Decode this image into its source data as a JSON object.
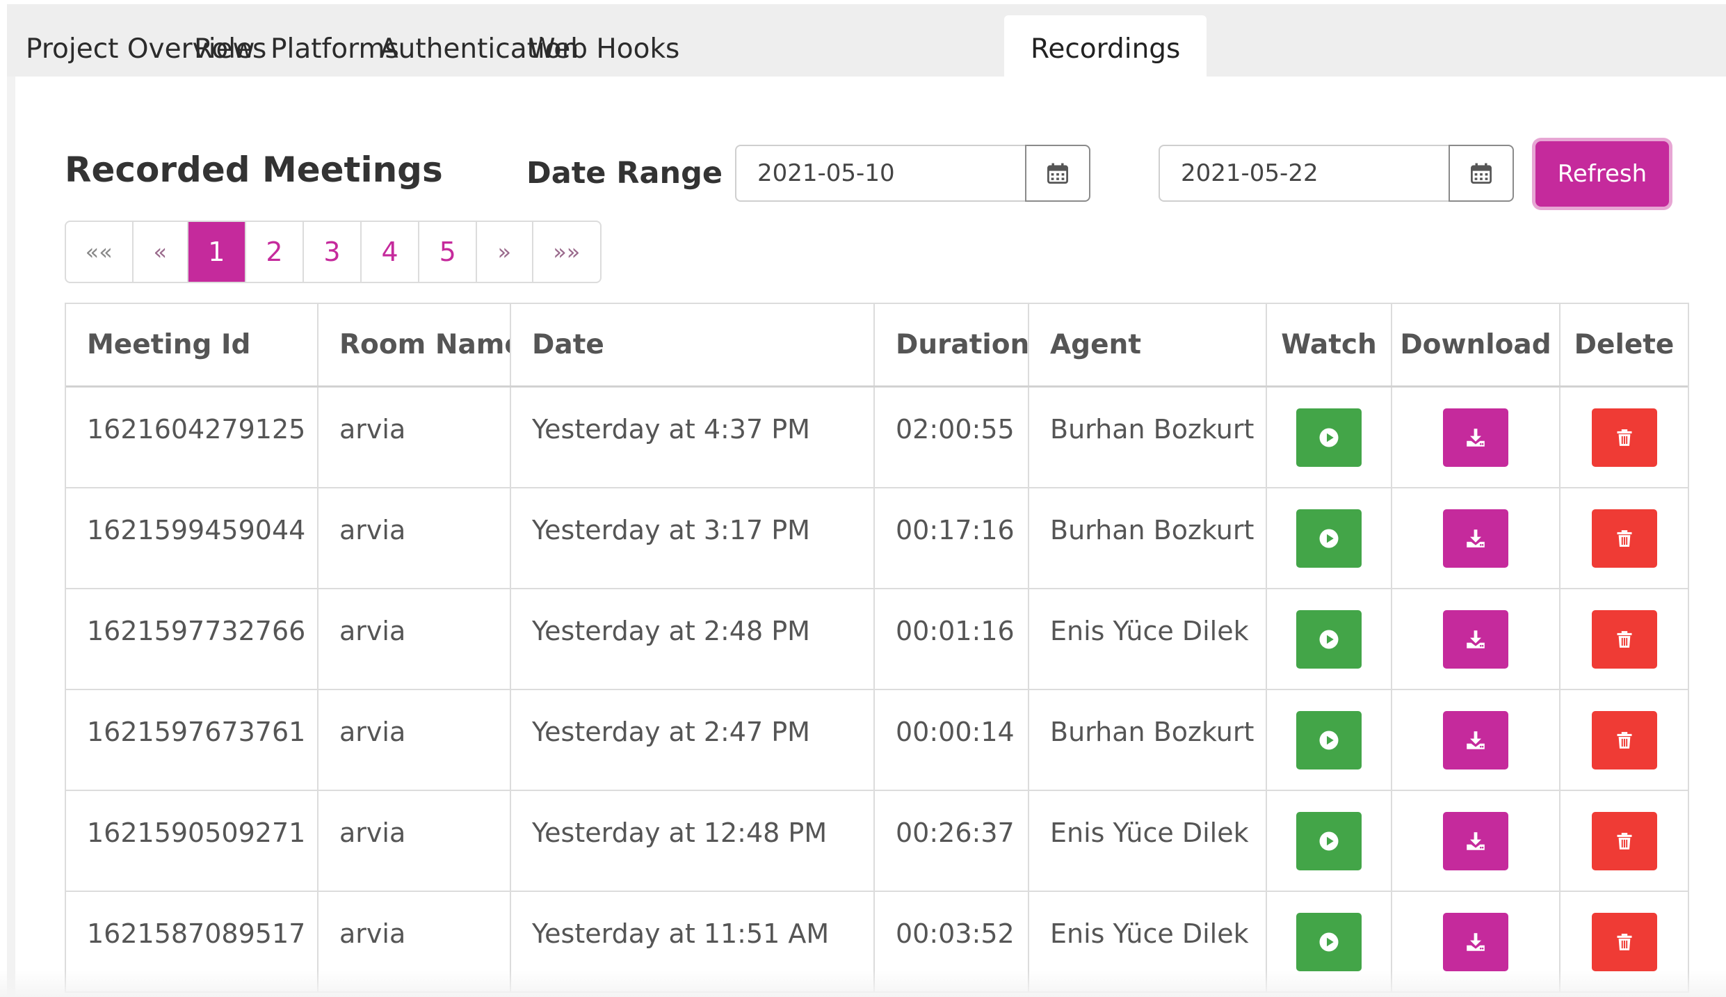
{
  "tabs": [
    {
      "label": "Project Overview"
    },
    {
      "label": "Roles"
    },
    {
      "label": "Platforms"
    },
    {
      "label": "Authentication"
    },
    {
      "label": "Web Hooks"
    },
    {
      "label": "Recordings",
      "active": true
    }
  ],
  "page": {
    "title": "Recorded Meetings",
    "date_range_label": "Date Range",
    "start_date": "2021-05-10",
    "end_date": "2021-05-22",
    "refresh_label": "Refresh",
    "calendar_icon": "calendar-icon"
  },
  "pagination": {
    "first": "««",
    "prev": "«",
    "pages": [
      "1",
      "2",
      "3",
      "4",
      "5"
    ],
    "current": "1",
    "next": "»",
    "last": "»»"
  },
  "table": {
    "columns": [
      "Meeting Id",
      "Room Name",
      "Date",
      "Duration",
      "Agent",
      "Watch",
      "Download",
      "Delete"
    ],
    "rows": [
      {
        "id": "1621604279125",
        "room": "arvia",
        "date": "Yesterday at 4:37 PM",
        "duration": "02:00:55",
        "agent": "Burhan Bozkurt"
      },
      {
        "id": "1621599459044",
        "room": "arvia",
        "date": "Yesterday at 3:17 PM",
        "duration": "00:17:16",
        "agent": "Burhan Bozkurt"
      },
      {
        "id": "1621597732766",
        "room": "arvia",
        "date": "Yesterday at 2:48 PM",
        "duration": "00:01:16",
        "agent": "Enis Yüce Dilek"
      },
      {
        "id": "1621597673761",
        "room": "arvia",
        "date": "Yesterday at 2:47 PM",
        "duration": "00:00:14",
        "agent": "Burhan Bozkurt"
      },
      {
        "id": "1621590509271",
        "room": "arvia",
        "date": "Yesterday at 12:48 PM",
        "duration": "00:26:37",
        "agent": "Enis Yüce Dilek"
      },
      {
        "id": "1621587089517",
        "room": "arvia",
        "date": "Yesterday at 11:51 AM",
        "duration": "00:03:52",
        "agent": "Enis Yüce Dilek"
      }
    ],
    "actions": {
      "watch_icon": "play-icon",
      "download_icon": "download-icon",
      "delete_icon": "trash-icon"
    }
  },
  "colors": {
    "accent": "#c52a9c",
    "watch": "#43a548",
    "delete": "#ef3b35"
  }
}
